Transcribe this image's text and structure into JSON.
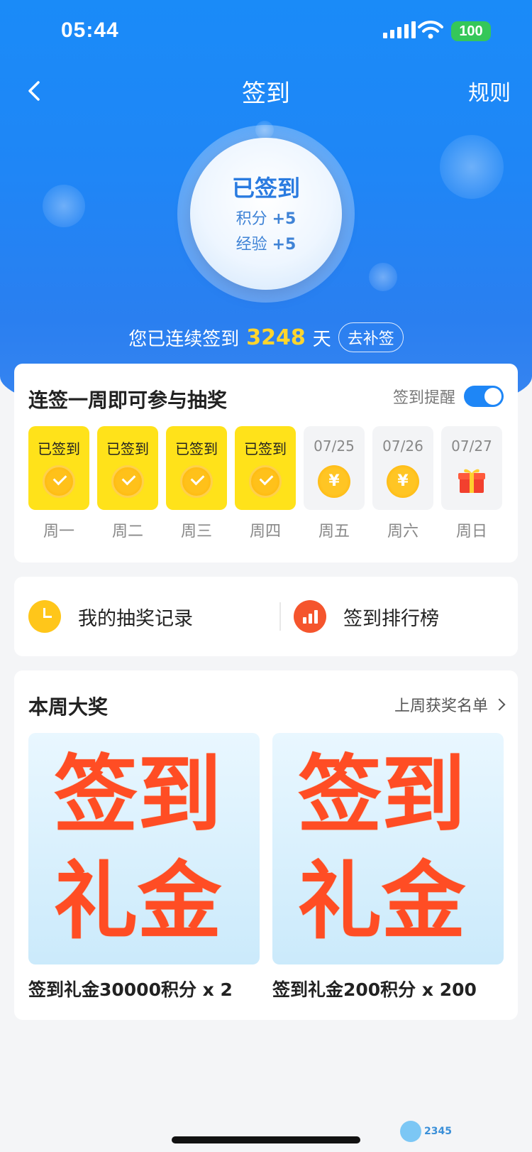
{
  "status_bar": {
    "time": "05:44",
    "battery": "100"
  },
  "nav": {
    "title": "签到",
    "right": "规则"
  },
  "hero": {
    "signed": "已签到",
    "points_label": "积分",
    "points_value": "+5",
    "exp_label": "经验",
    "exp_value": "+5"
  },
  "streak": {
    "prefix": "您已连续签到",
    "count": "3248",
    "suffix": "天",
    "makeup": "去补签"
  },
  "week_card": {
    "title": "连签一周即可参与抽奖",
    "reminder": "签到提醒",
    "reminder_on": true,
    "days": [
      {
        "top": "已签到",
        "label": "周一",
        "state": "signed"
      },
      {
        "top": "已签到",
        "label": "周二",
        "state": "signed"
      },
      {
        "top": "已签到",
        "label": "周三",
        "state": "signed"
      },
      {
        "top": "已签到",
        "label": "周四",
        "state": "signed"
      },
      {
        "top": "07/25",
        "label": "周五",
        "state": "coin",
        "coin": "¥"
      },
      {
        "top": "07/26",
        "label": "周六",
        "state": "coin",
        "coin": "¥"
      },
      {
        "top": "07/27",
        "label": "周日",
        "state": "gift"
      }
    ]
  },
  "links": {
    "draw_record": "我的抽奖记录",
    "ranking": "签到排行榜"
  },
  "prizes": {
    "title": "本周大奖",
    "winners_link": "上周获奖名单",
    "items": [
      {
        "img_line1": "签到",
        "img_line2": "礼金",
        "name": "签到礼金30000积分 x 2"
      },
      {
        "img_line1": "签到",
        "img_line2": "礼金",
        "name": "签到礼金200积分 x 200"
      }
    ]
  },
  "colors": {
    "primary": "#1e86f6",
    "gold": "#ffe21a",
    "accent_red": "#ff4d24"
  },
  "watermark": "2345"
}
